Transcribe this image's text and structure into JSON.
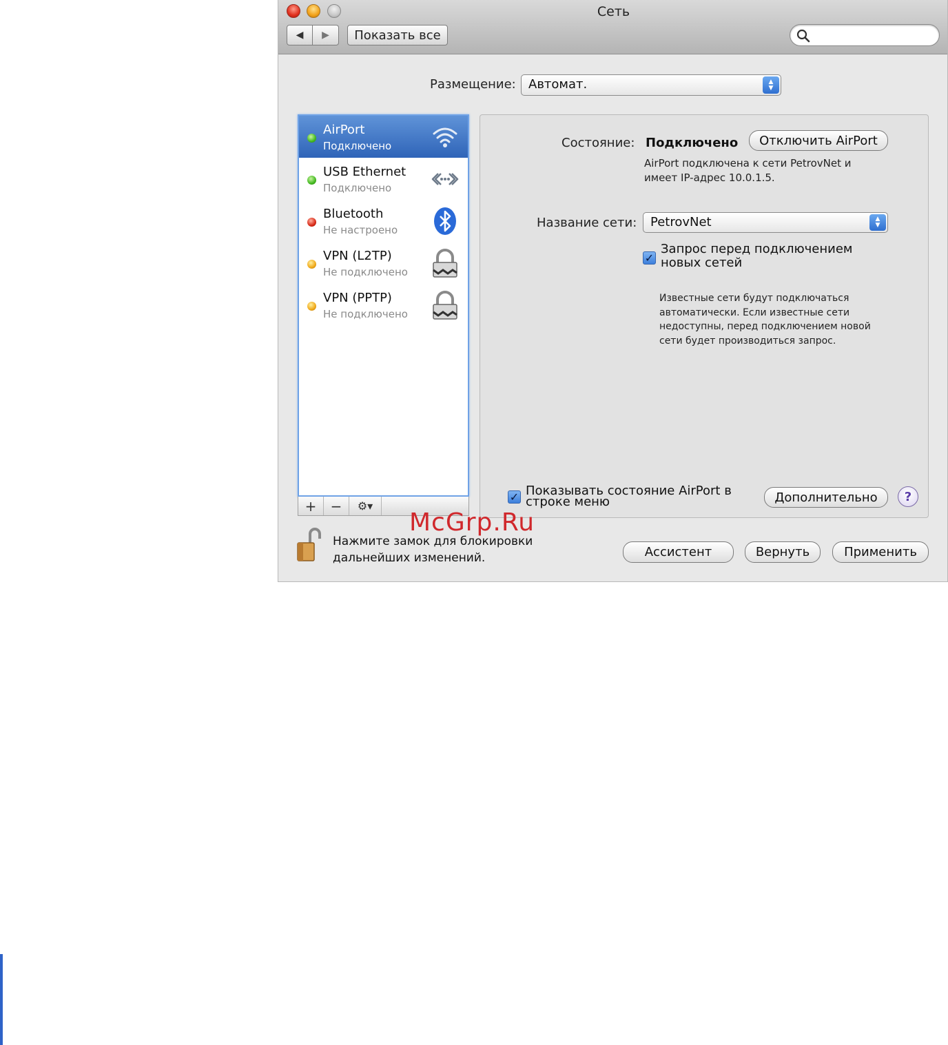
{
  "window": {
    "title": "Сеть",
    "show_all": "Показать все",
    "search": {
      "placeholder": ""
    }
  },
  "location": {
    "label": "Размещение:",
    "value": "Автомат."
  },
  "services": [
    {
      "name": "AirPort",
      "status": "Подключено",
      "dot": "green",
      "icon": "wifi-icon",
      "selected": true
    },
    {
      "name": "USB Ethernet",
      "status": "Подключено",
      "dot": "green",
      "icon": "ethernet-icon",
      "selected": false
    },
    {
      "name": "Bluetooth",
      "status": "Не настроено",
      "dot": "red",
      "icon": "bluetooth-icon",
      "selected": false
    },
    {
      "name": "VPN (L2TP)",
      "status": "Не подключено",
      "dot": "yellow",
      "icon": "lock-icon",
      "selected": false
    },
    {
      "name": "VPN (PPTP)",
      "status": "Не подключено",
      "dot": "yellow",
      "icon": "lock-icon",
      "selected": false
    }
  ],
  "list_toolbar": {
    "add": "+",
    "remove": "−",
    "actions": "⚙▾"
  },
  "detail": {
    "status_label": "Состояние:",
    "status_value": "Подключено",
    "turn_off_button": "Отключить AirPort",
    "status_description": "AirPort подключена к сети PetrovNet и имеет IP-адрес 10.0.1.5.",
    "network_label": "Название сети:",
    "network_value": "PetrovNet",
    "ask_checkbox_label": "Запрос перед подключением новых сетей",
    "ask_checked": true,
    "known_networks_text": "Известные сети будут подключаться автоматически. Если известные сети недоступны, перед подключением новой сети будет производиться запрос.",
    "menu_checkbox_label": "Показывать состояние AirPort в строке меню",
    "menu_checked": true,
    "advanced_button": "Дополнительно",
    "help_button": "?"
  },
  "bottom": {
    "lock_text": "Нажмите замок для блокировки дальнейших изменений.",
    "assistant_button": "Ассистент",
    "revert_button": "Вернуть",
    "apply_button": "Применить"
  },
  "watermark": "McGrp.Ru",
  "colors": {
    "selection": "#2f64b8",
    "accent": "#3d7fdc",
    "watermark": "#d0282c"
  }
}
